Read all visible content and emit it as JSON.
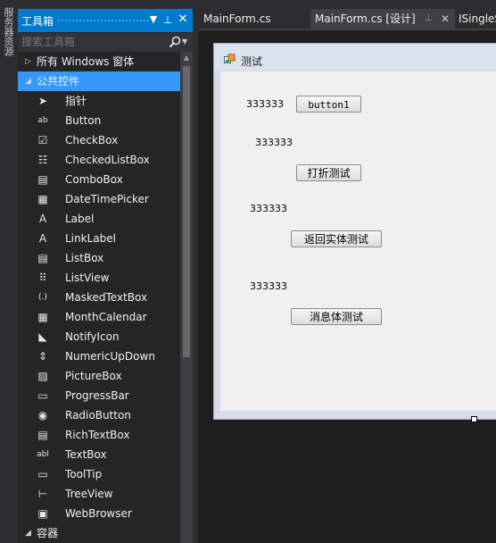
{
  "left_strip": {
    "label": "服务器资源"
  },
  "toolbox": {
    "title": "工具箱",
    "search_placeholder": "搜索工具箱",
    "groups": [
      {
        "label": "所有 Windows 窗体",
        "expanded": false
      },
      {
        "label": "公共控件",
        "expanded": true,
        "selected": true
      },
      {
        "label": "容器",
        "expanded": true
      }
    ],
    "items": [
      {
        "label": "指针",
        "icon": "pointer-icon",
        "glyph": "➤"
      },
      {
        "label": "Button",
        "icon": "button-icon",
        "glyph": "ab"
      },
      {
        "label": "CheckBox",
        "icon": "checkbox-icon",
        "glyph": "☑"
      },
      {
        "label": "CheckedListBox",
        "icon": "checked-list-icon",
        "glyph": "☷"
      },
      {
        "label": "ComboBox",
        "icon": "combobox-icon",
        "glyph": "▤"
      },
      {
        "label": "DateTimePicker",
        "icon": "datetimepicker-icon",
        "glyph": "▦"
      },
      {
        "label": "Label",
        "icon": "label-icon",
        "glyph": "A"
      },
      {
        "label": "LinkLabel",
        "icon": "linklabel-icon",
        "glyph": "A"
      },
      {
        "label": "ListBox",
        "icon": "listbox-icon",
        "glyph": "▤"
      },
      {
        "label": "ListView",
        "icon": "listview-icon",
        "glyph": "⠿"
      },
      {
        "label": "MaskedTextBox",
        "icon": "maskedtextbox-icon",
        "glyph": "(.)"
      },
      {
        "label": "MonthCalendar",
        "icon": "monthcalendar-icon",
        "glyph": "▦"
      },
      {
        "label": "NotifyIcon",
        "icon": "notifyicon-icon",
        "glyph": "◣"
      },
      {
        "label": "NumericUpDown",
        "icon": "numericupdown-icon",
        "glyph": "⇕"
      },
      {
        "label": "PictureBox",
        "icon": "picturebox-icon",
        "glyph": "▨"
      },
      {
        "label": "ProgressBar",
        "icon": "progressbar-icon",
        "glyph": "▭"
      },
      {
        "label": "RadioButton",
        "icon": "radiobutton-icon",
        "glyph": "◉"
      },
      {
        "label": "RichTextBox",
        "icon": "richtextbox-icon",
        "glyph": "▤"
      },
      {
        "label": "TextBox",
        "icon": "textbox-icon",
        "glyph": "abl"
      },
      {
        "label": "ToolTip",
        "icon": "tooltip-icon",
        "glyph": "▭"
      },
      {
        "label": "TreeView",
        "icon": "treeview-icon",
        "glyph": "⊢"
      },
      {
        "label": "WebBrowser",
        "icon": "webbrowser-icon",
        "glyph": "▣"
      }
    ]
  },
  "tabs": [
    {
      "label": "MainForm.cs",
      "active": false
    },
    {
      "label": "MainForm.cs [设计]",
      "active": true
    },
    {
      "label": "ISingleS",
      "active": false
    }
  ],
  "form": {
    "title": "测试",
    "labels": [
      "333333",
      "333333",
      "333333",
      "333333"
    ],
    "buttons": [
      "button1",
      "打折测试",
      "返回实体测试",
      "消息体测试"
    ]
  },
  "colors": {
    "accent": "#007acc",
    "selected": "#3399ff",
    "panel": "#252526",
    "designer": "#1e1e1e"
  }
}
